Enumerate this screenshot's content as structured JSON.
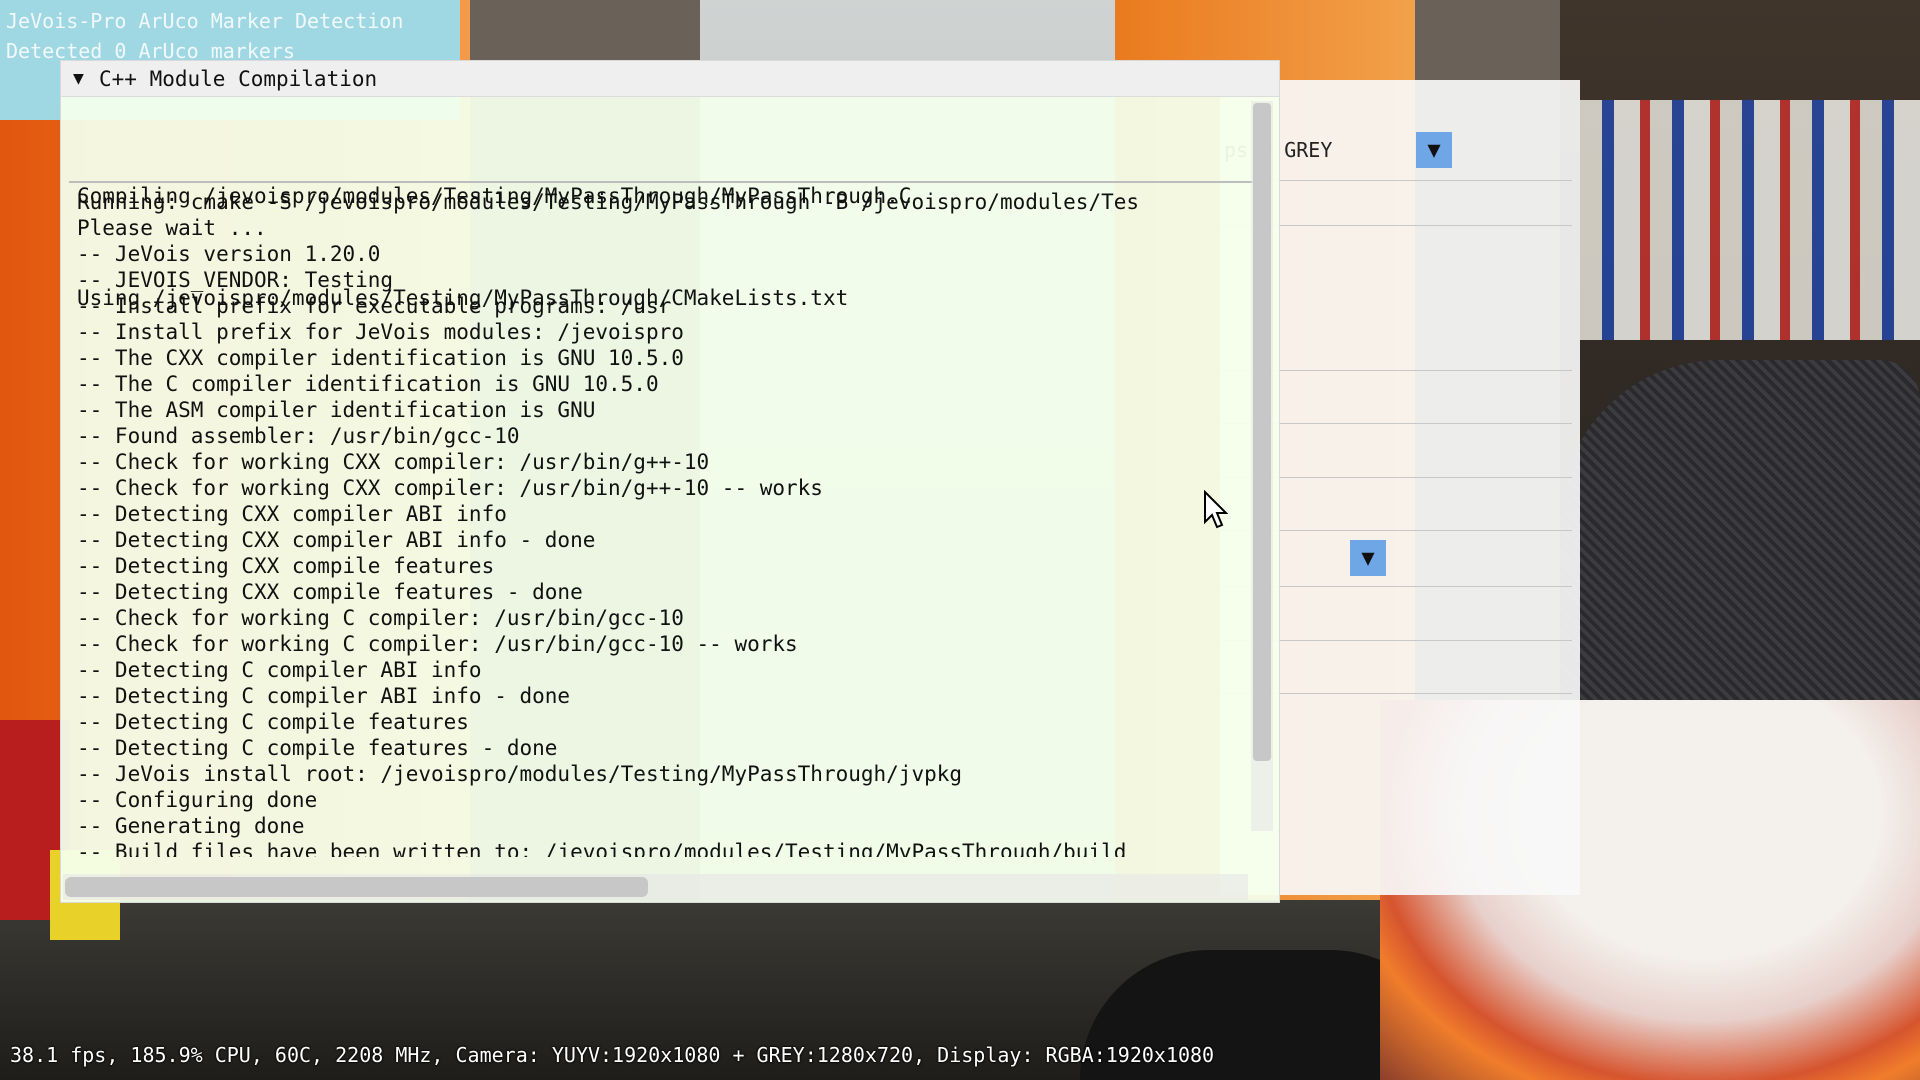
{
  "overlay": {
    "title_line1": "JeVois-Pro ArUco Marker Detection",
    "title_line2": "Detected 0 ArUco markers"
  },
  "background_panel": {
    "mode_text": "ps + GREY",
    "dropdown_icon": "triangle-down-icon"
  },
  "window": {
    "title": "C++ Module Compilation",
    "collapse_icon": "triangle-down-icon",
    "header_lines": [
      "Compiling /jevoispro/modules/Testing/MyPassThrough/MyPassThrough.C",
      "Using /jevoispro/modules/Testing/MyPassThrough/CMakeLists.txt"
    ],
    "log_lines": [
      "Running: cmake -S /jevoispro/modules/Testing/MyPassThrough -B /jevoispro/modules/Tes",
      "Please wait ...",
      "-- JeVois version 1.20.0",
      "-- JEVOIS_VENDOR: Testing",
      "-- Install prefix for executable programs: /usr",
      "-- Install prefix for JeVois modules: /jevoispro",
      "-- The CXX compiler identification is GNU 10.5.0",
      "-- The C compiler identification is GNU 10.5.0",
      "-- The ASM compiler identification is GNU",
      "-- Found assembler: /usr/bin/gcc-10",
      "-- Check for working CXX compiler: /usr/bin/g++-10",
      "-- Check for working CXX compiler: /usr/bin/g++-10 -- works",
      "-- Detecting CXX compiler ABI info",
      "-- Detecting CXX compiler ABI info - done",
      "-- Detecting CXX compile features",
      "-- Detecting CXX compile features - done",
      "-- Check for working C compiler: /usr/bin/gcc-10",
      "-- Check for working C compiler: /usr/bin/gcc-10 -- works",
      "-- Detecting C compiler ABI info",
      "-- Detecting C compiler ABI info - done",
      "-- Detecting C compile features",
      "-- Detecting C compile features - done",
      "-- JeVois install root: /jevoispro/modules/Testing/MyPassThrough/jvpkg",
      "-- Configuring done",
      "-- Generating done",
      "-- Build files have been written to: /jevoispro/modules/Testing/MyPassThrough/build"
    ]
  },
  "status_bar": {
    "text": "38.1 fps, 185.9% CPU, 60C, 2208 MHz, Camera: YUYV:1920x1080 + GREY:1280x720, Display: RGBA:1920x1080"
  },
  "colors": {
    "window_bg": "#f4ffec",
    "dropdown_accent": "#6fa6e6",
    "scroll_thumb": "#c7c7c7"
  }
}
